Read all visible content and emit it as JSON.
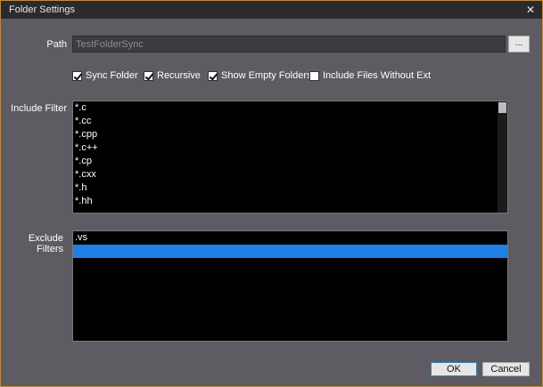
{
  "window": {
    "title": "Folder Settings",
    "close_glyph": "✕"
  },
  "path": {
    "label": "Path",
    "value": "TestFolderSync",
    "browse_label": "..."
  },
  "options": [
    {
      "label": "Sync Folder",
      "checked": true
    },
    {
      "label": "Recursive",
      "checked": true
    },
    {
      "label": "Show Empty Folders",
      "checked": true
    },
    {
      "label": "Include Files Without Ext",
      "checked": false
    }
  ],
  "include_filter": {
    "label": "Include Filter",
    "items": [
      "*.c",
      "*.cc",
      "*.cpp",
      "*.c++",
      "*.cp",
      "*.cxx",
      "*.h",
      "*.hh"
    ]
  },
  "exclude_filters": {
    "label": "Exclude Filters",
    "items": [
      ".vs",
      ""
    ],
    "selected_index": 1
  },
  "buttons": {
    "ok": "OK",
    "cancel": "Cancel"
  },
  "colors": {
    "selection": "#1e7fe6",
    "window_border": "#c28a3a",
    "background": "#5e5b62"
  }
}
